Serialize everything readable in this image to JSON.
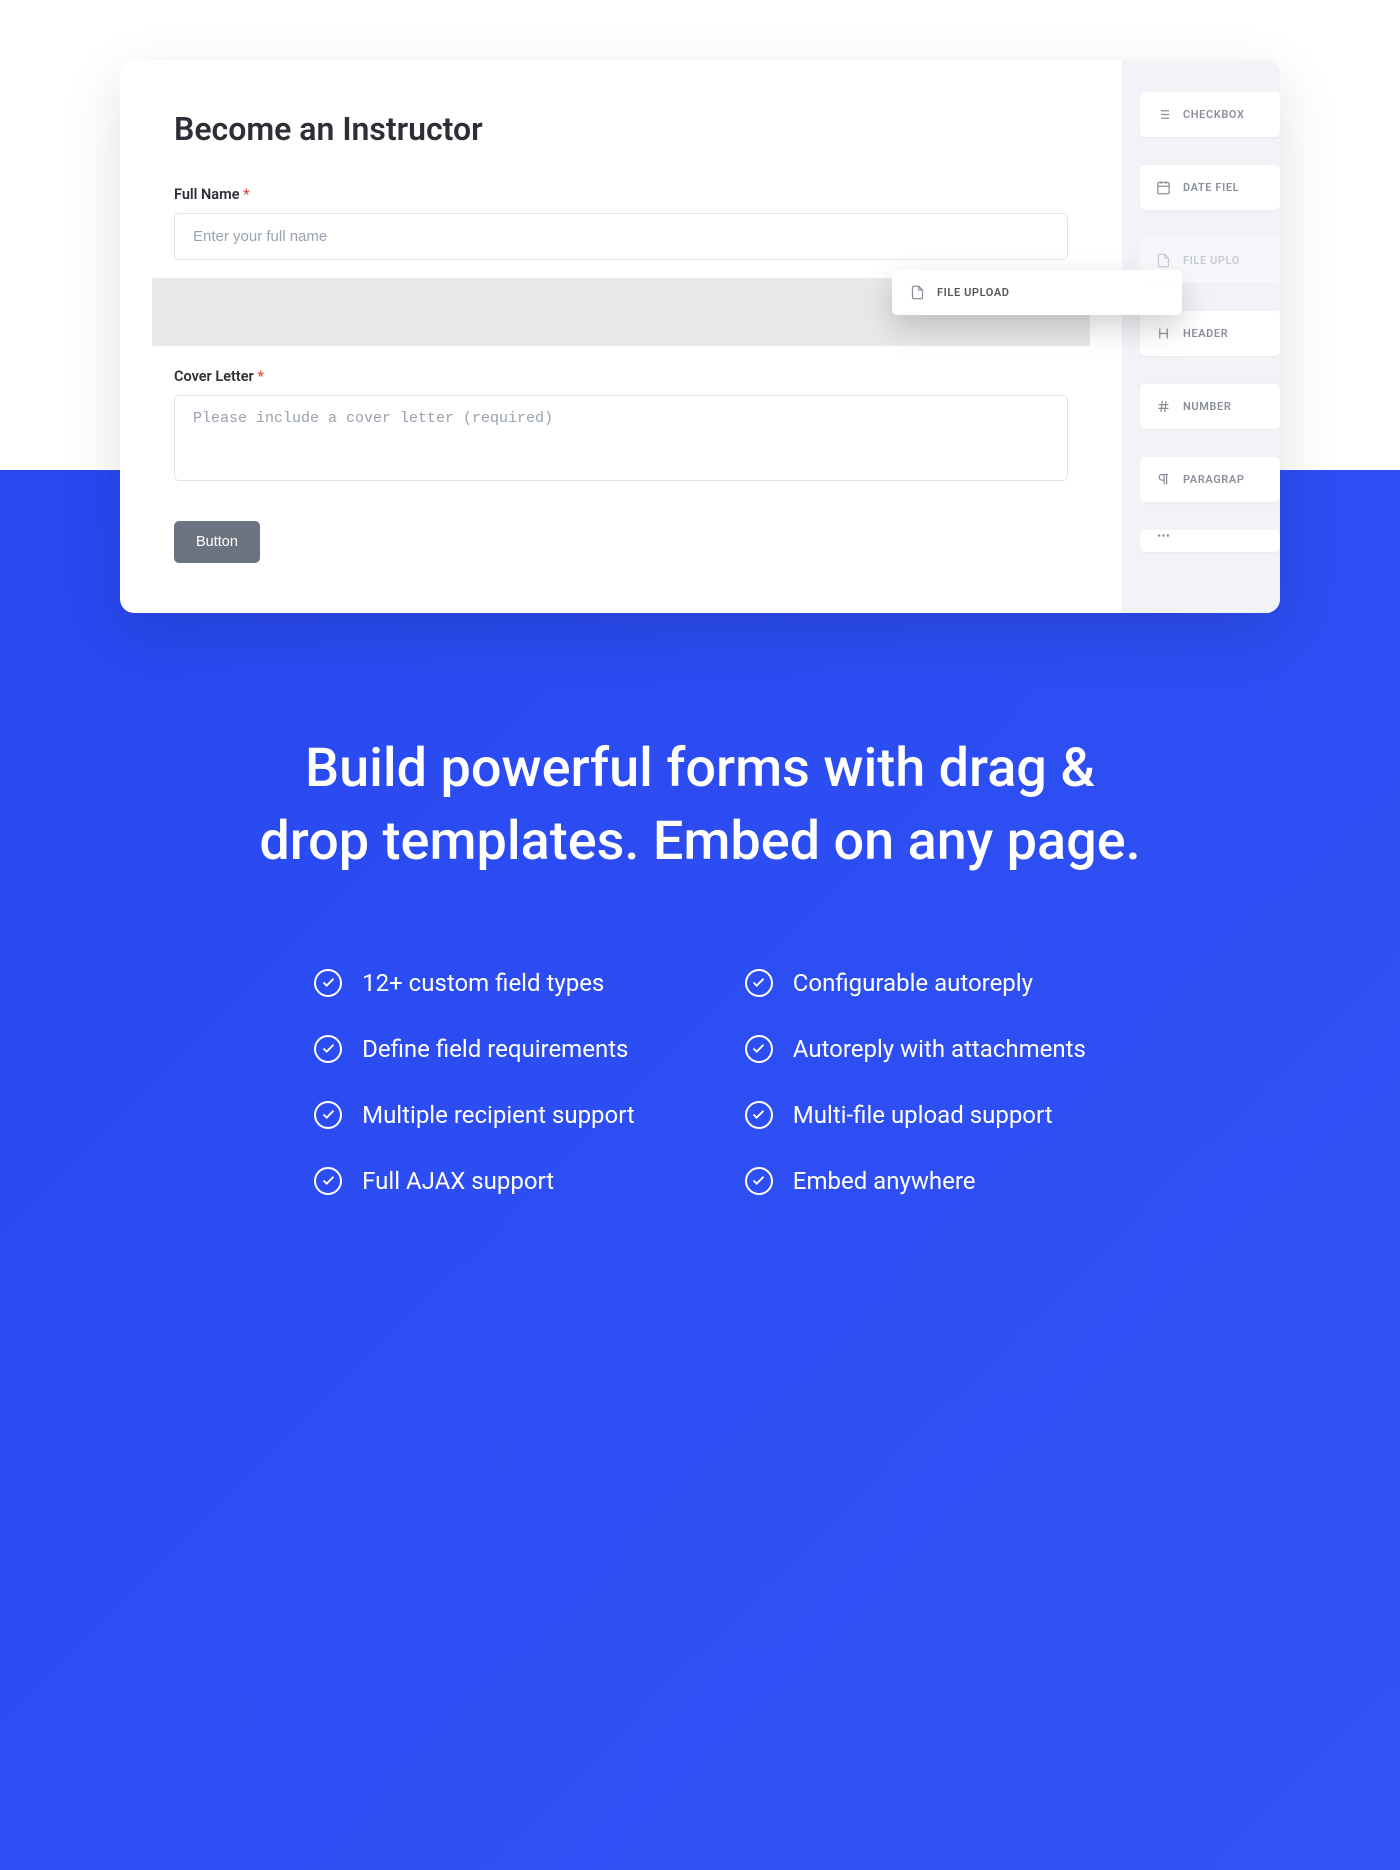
{
  "form": {
    "title": "Become an Instructor",
    "fields": {
      "fullname_label": "Full Name",
      "fullname_placeholder": "Enter your full name",
      "cover_label": "Cover Letter",
      "cover_placeholder": "Please include a cover letter (required)"
    },
    "submit_label": "Button"
  },
  "dragging_label": "FILE UPLOAD",
  "palette": {
    "items": [
      {
        "label": "CHECKBOX",
        "icon": "list"
      },
      {
        "label": "DATE FIEL",
        "icon": "calendar"
      },
      {
        "label": "FILE UPLO",
        "icon": "upload"
      },
      {
        "label": "HEADER",
        "icon": "header"
      },
      {
        "label": "NUMBER",
        "icon": "hash"
      },
      {
        "label": "PARAGRAP",
        "icon": "paragraph"
      }
    ]
  },
  "hero": {
    "headline": "Build powerful forms with drag & drop templates. Embed on any page."
  },
  "features": {
    "left": [
      "12+ custom field types",
      "Define field requirements",
      "Multiple recipient support",
      "Full AJAX support"
    ],
    "right": [
      "Configurable autoreply",
      "Autoreply with attachments",
      "Multi-file upload support",
      "Embed anywhere"
    ]
  }
}
